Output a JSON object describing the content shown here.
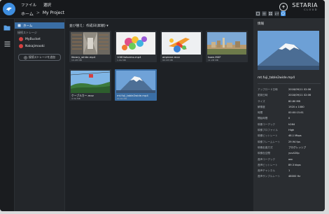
{
  "menu": {
    "file": "ファイル",
    "select": "選択"
  },
  "breadcrumb": {
    "home": "ホーム",
    "separator": ">",
    "current": "My Project"
  },
  "brand": {
    "name": "SETARIA",
    "tagline": "CLOUD"
  },
  "sidebar": {
    "home_label": "ホーム",
    "section_label": "接続ストレージ",
    "storages": [
      {
        "label": "MyBucket"
      },
      {
        "label": "Nakajimaoki"
      }
    ],
    "add_storage_label": "接続ストレージを追加"
  },
  "main": {
    "sort_label": "並び替え：作成日(昇順) ▾",
    "files": [
      {
        "name": "library_white.mp4",
        "size": "10.2M MB"
      },
      {
        "name": "1080lotsemo.mp4",
        "size": "1.9G MB"
      },
      {
        "name": "airplane.mov",
        "size": "90.1M MB"
      },
      {
        "name": "town.MXF",
        "size": "11.2M MB"
      },
      {
        "name": "ケーブルカー.mov",
        "size": "4.3G MB"
      },
      {
        "name": "mt.fuji_table2wide.mp4",
        "size": "80.80 MB"
      }
    ]
  },
  "info": {
    "title": "情報",
    "filename": "mt.fuji_table2wide.mp4",
    "properties": [
      {
        "key": "アップロード日時",
        "value": "2018/09/11 02:06"
      },
      {
        "key": "更新日時",
        "value": "2018/09/11 02:06"
      },
      {
        "key": "サイズ",
        "value": "80.80 MB"
      },
      {
        "key": "解像度",
        "value": "1920 x 1080"
      },
      {
        "key": "時間",
        "value": "00:00:15.61"
      },
      {
        "key": "開始時間",
        "value": "0"
      },
      {
        "key": "映像コーデック",
        "value": "h264"
      },
      {
        "key": "映像プロファイル",
        "value": "High"
      },
      {
        "key": "映像ビットレート",
        "value": "48.1 Mbps"
      },
      {
        "key": "映像フレームレート",
        "value": "29.94 fps"
      },
      {
        "key": "映像走査方式",
        "value": "プログレッシブ"
      },
      {
        "key": "映像色空間",
        "value": "yuv420p"
      },
      {
        "key": "音声コーデック",
        "value": "aac"
      },
      {
        "key": "音声ビットレート",
        "value": "89.3 kbps"
      },
      {
        "key": "音声チャンネル",
        "value": "1"
      },
      {
        "key": "音声サンプルレート",
        "value": "48000 Hz"
      }
    ]
  }
}
